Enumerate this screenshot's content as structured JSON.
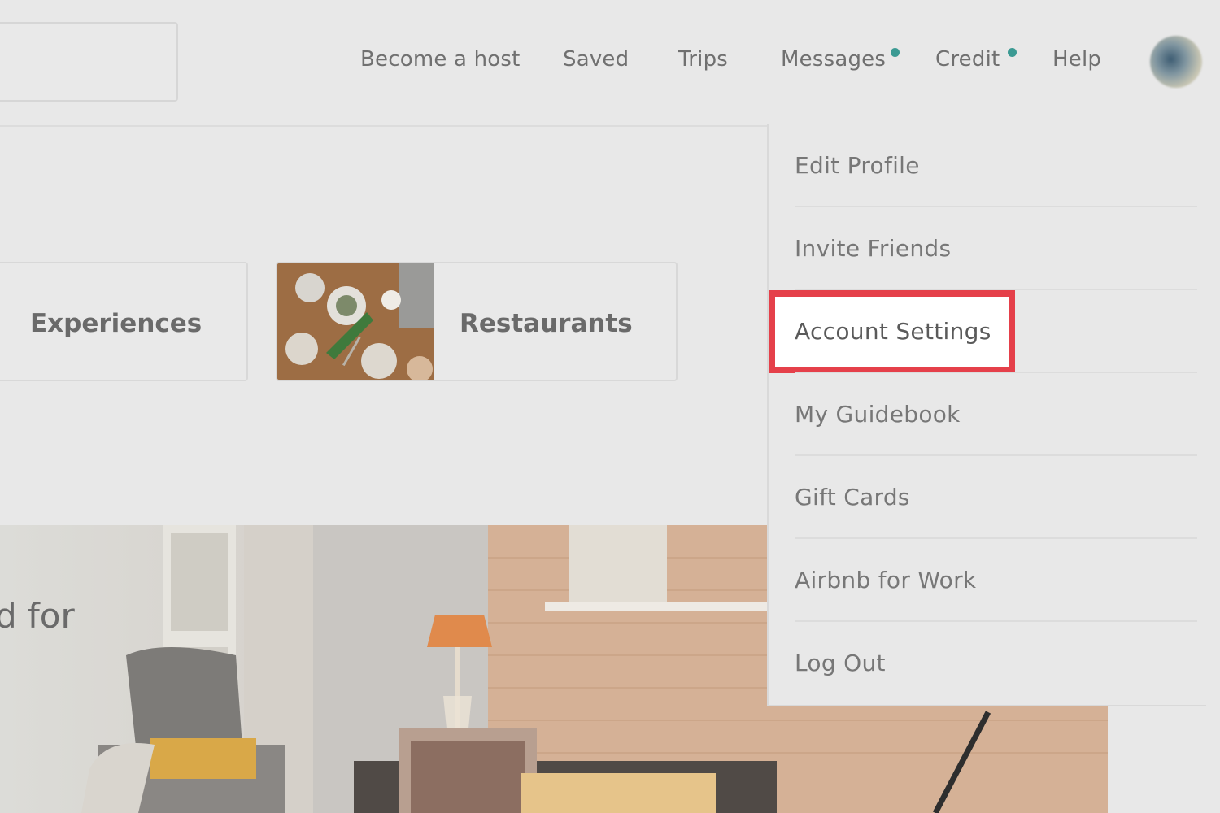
{
  "nav": {
    "items": [
      "Become a host",
      "Saved",
      "Trips",
      "Messages",
      "Credit",
      "Help"
    ],
    "accent": "#3b9a93"
  },
  "cards": {
    "experiences": "Experiences",
    "restaurants": "Restaurants"
  },
  "hero": {
    "text": "d for"
  },
  "menu": {
    "items": [
      "Edit Profile",
      "Invite Friends",
      "Account Settings",
      "My Guidebook",
      "Gift Cards",
      "Airbnb for Work",
      "Log Out"
    ],
    "highlight_color": "#e5404a"
  },
  "icons": [
    "avatar-image",
    "notification-dot"
  ]
}
